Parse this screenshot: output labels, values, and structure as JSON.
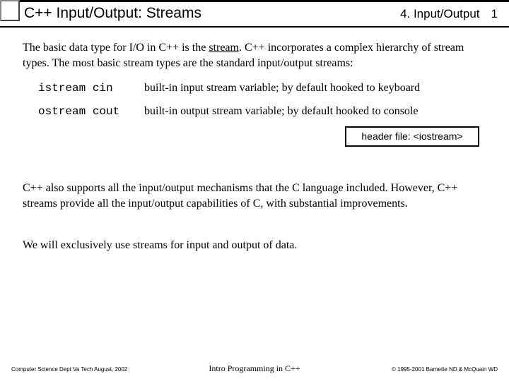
{
  "header": {
    "title": "C++ Input/Output: Streams",
    "section": "4. Input/Output",
    "page": "1"
  },
  "intro": {
    "pre": "The basic data type for I/O in C++ is the ",
    "underlined": "stream",
    "post": ".  C++ incorporates a complex hierarchy of stream types.  The most basic stream types are the standard input/output streams:"
  },
  "definitions": [
    {
      "term": "istream cin",
      "desc": "built-in input stream variable; by default hooked to keyboard"
    },
    {
      "term": "ostream cout",
      "desc": "built-in output stream variable; by default hooked to console"
    }
  ],
  "header_file_box": "header file: <iostream>",
  "para2": "C++ also supports all the input/output mechanisms that the C language included.  However, C++ streams provide all the input/output capabilities of C, with substantial improvements.",
  "para3": "We will exclusively use streams for input and output of data.",
  "footer": {
    "left": "Computer Science Dept Va Tech  August, 2002",
    "center": "Intro Programming in C++",
    "right": "© 1995-2001  Barnette ND & McQuain WD"
  }
}
